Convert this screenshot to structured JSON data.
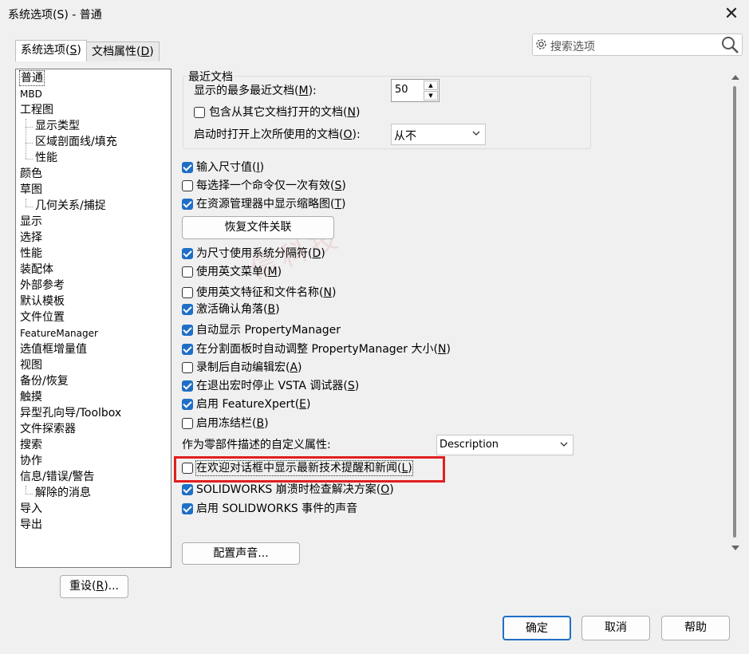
{
  "window": {
    "title": "系统选项(S) - 普通",
    "close_glyph": "✕"
  },
  "tabs": [
    {
      "label": "系统选项",
      "mnemonic": "S"
    },
    {
      "label": "文档属性",
      "mnemonic": "D"
    }
  ],
  "search": {
    "placeholder": "搜索选项"
  },
  "tree": [
    {
      "label": "普通",
      "selected": true
    },
    {
      "label": "MBD"
    },
    {
      "label": "工程图"
    },
    {
      "label": "显示类型",
      "child": true
    },
    {
      "label": "区域剖面线/填充",
      "child": true
    },
    {
      "label": "性能",
      "child": true
    },
    {
      "label": "颜色"
    },
    {
      "label": "草图"
    },
    {
      "label": "几何关系/捕捉",
      "child": true
    },
    {
      "label": "显示"
    },
    {
      "label": "选择"
    },
    {
      "label": "性能"
    },
    {
      "label": "装配体"
    },
    {
      "label": "外部参考"
    },
    {
      "label": "默认模板"
    },
    {
      "label": "文件位置"
    },
    {
      "label": "FeatureManager"
    },
    {
      "label": "选值框增量值"
    },
    {
      "label": "视图"
    },
    {
      "label": "备份/恢复"
    },
    {
      "label": "触摸"
    },
    {
      "label": "异型孔向导/Toolbox"
    },
    {
      "label": "文件探索器"
    },
    {
      "label": "搜索"
    },
    {
      "label": "协作"
    },
    {
      "label": "信息/错误/警告"
    },
    {
      "label": "解除的消息",
      "child": true
    },
    {
      "label": "导入"
    },
    {
      "label": "导出"
    }
  ],
  "reset_button": {
    "label": "重设",
    "mnemonic": "R",
    "suffix": "..."
  },
  "recent_docs": {
    "group_title": "最近文档",
    "max_label": "显示的最多最近文档",
    "max_mnemonic": "M",
    "max_value": "50",
    "include_label": "包含从其它文档打开的文档",
    "include_mnemonic": "N",
    "include_checked": false,
    "open_last_label": "启动时打开上次所使用的文档",
    "open_last_mnemonic": "O",
    "open_last_value": "从不"
  },
  "options": [
    {
      "label": "输入尺寸值",
      "mnemonic": "I",
      "checked": true
    },
    {
      "label": "每选择一个命令仅一次有效",
      "mnemonic": "S",
      "checked": false
    },
    {
      "label": "在资源管理器中显示缩略图",
      "mnemonic": "T",
      "checked": true
    }
  ],
  "restore_button": {
    "label": "恢复文件关联"
  },
  "options2": [
    {
      "label": "为尺寸使用系统分隔符",
      "mnemonic": "D",
      "checked": true
    },
    {
      "label": "使用英文菜单",
      "mnemonic": "M",
      "checked": false
    },
    {
      "label": "使用英文特征和文件名称",
      "mnemonic": "N",
      "checked": false
    },
    {
      "label": "激活确认角落",
      "mnemonic": "B",
      "checked": true
    },
    {
      "label": "自动显示 PropertyManager",
      "mnemonic": "",
      "checked": true
    },
    {
      "label": "在分割面板时自动调整 PropertyManager 大小",
      "mnemonic": "N",
      "checked": true
    },
    {
      "label": "录制后自动编辑宏",
      "mnemonic": "A",
      "checked": false
    },
    {
      "label": "在退出宏时停止 VSTA 调试器",
      "mnemonic": "S",
      "checked": true
    },
    {
      "label": "启用 FeatureXpert",
      "mnemonic": "E",
      "checked": true
    },
    {
      "label": "启用冻结栏",
      "mnemonic": "B",
      "checked": false
    }
  ],
  "custom_property": {
    "label": "作为零部件描述的自定义属性:",
    "value": "Description"
  },
  "options3": [
    {
      "label": "在欢迎对话框中显示最新技术提醒和新闻",
      "mnemonic": "L",
      "checked": false
    },
    {
      "label": "SOLIDWORKS 崩溃时检查解决方案",
      "mnemonic": "O",
      "checked": true
    },
    {
      "label": "启用 SOLIDWORKS 事件的声音",
      "mnemonic": "",
      "checked": true
    }
  ],
  "sound_button": {
    "label": "配置声音..."
  },
  "watermark": "信科技",
  "footer": {
    "ok": "确定",
    "cancel": "取消",
    "help": "帮助"
  },
  "colors": {
    "accent": "#1f6fc6",
    "highlight": "#e11f1f"
  },
  "icons": [
    "close-icon",
    "gear-icon",
    "search-icon",
    "chevron-down-icon",
    "checkbox-checked-icon",
    "checkbox-unchecked-icon"
  ]
}
